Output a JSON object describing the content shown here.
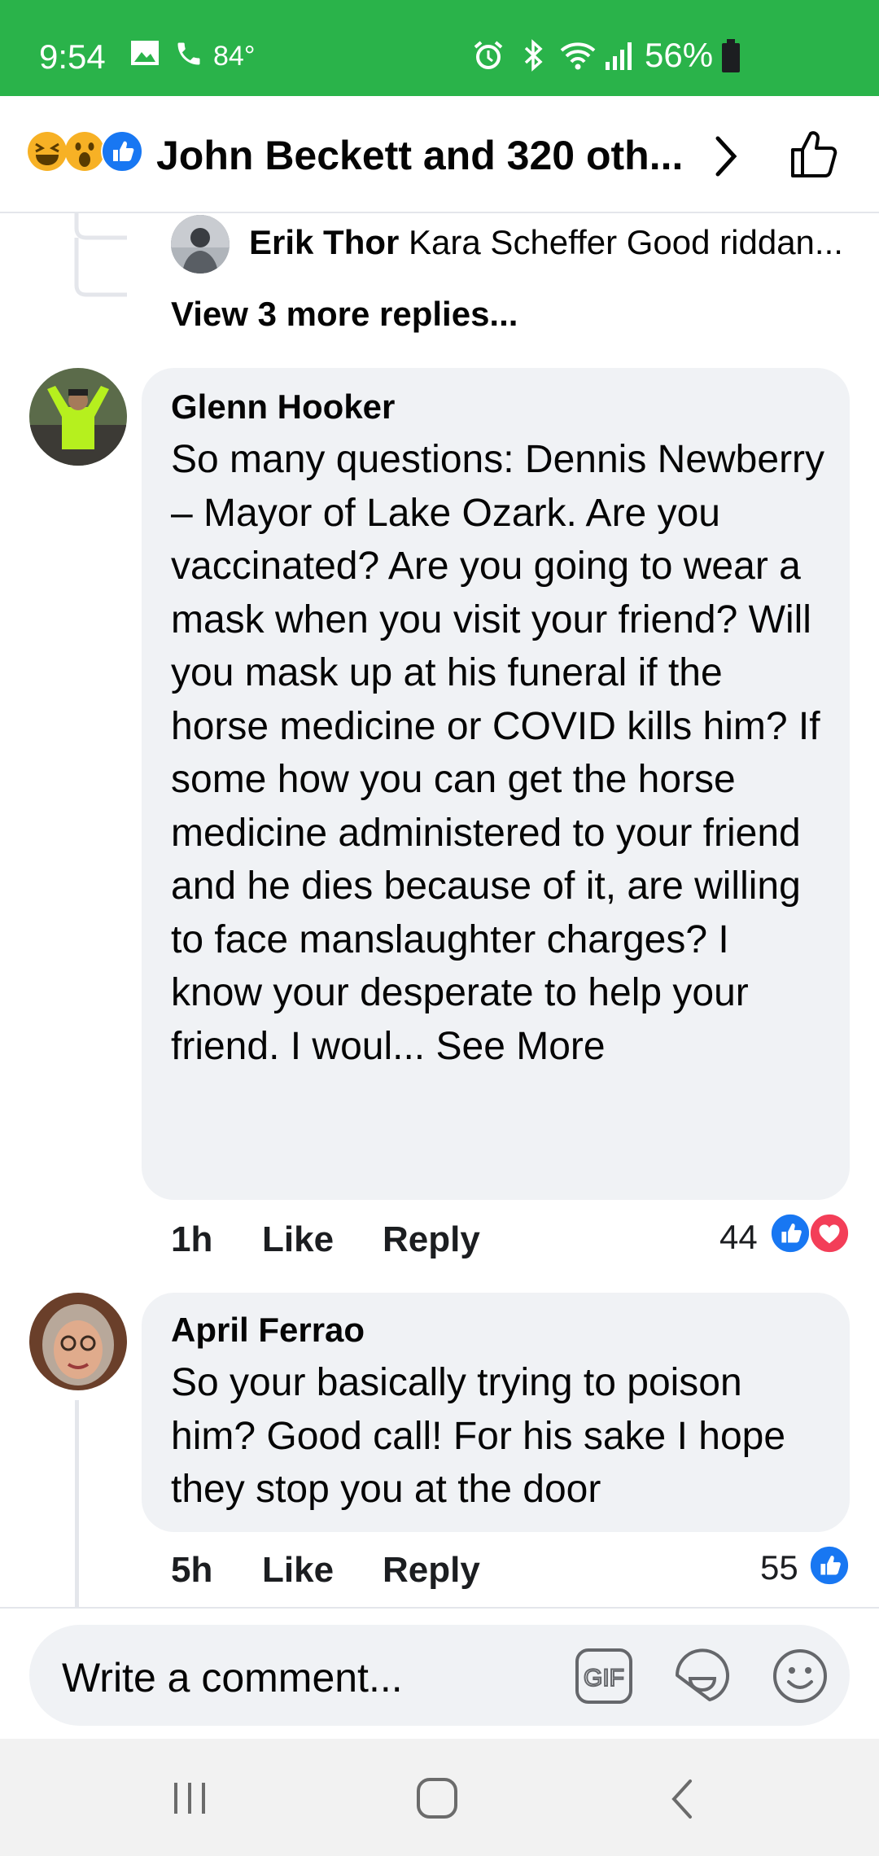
{
  "status_bar": {
    "time": "9:54",
    "temperature": "84°",
    "battery": "56%"
  },
  "header": {
    "title": "John Beckett and 320 oth...",
    "reactions": [
      "laugh-emoji",
      "wow-emoji",
      "like"
    ]
  },
  "previous_reply": {
    "author": "Erik Thor",
    "preview": "Kara Scheffer Good riddan..."
  },
  "view_more": "View 3 more replies...",
  "comments": [
    {
      "author": "Glenn Hooker",
      "text": "So many questions: Dennis Newberry –  Mayor of Lake Ozark. Are you vaccinated? Are you going to wear a mask when you visit your friend? Will you mask up at his funeral if the horse medicine or COVID kills him? If some how you can get the horse medicine administered to your friend and he dies because of it, are willing to face manslaughter charges?  I know your desperate to help your friend. I woul...",
      "see_more": "See More",
      "time": "1h",
      "like": "Like",
      "reply": "Reply",
      "reaction_count": "44",
      "reactions": [
        "like",
        "love"
      ]
    },
    {
      "author": "April Ferrao",
      "text": "So your basically trying to poison him?  Good call!  For his sake I hope they stop you at the door",
      "time": "5h",
      "like": "Like",
      "reply": "Reply",
      "reaction_count": "55",
      "reactions": [
        "like"
      ]
    }
  ],
  "composer": {
    "placeholder": "Write a comment..."
  },
  "colors": {
    "status_green": "#2ab34a",
    "fb_blue": "#1877f2",
    "love_red": "#f33e58",
    "bubble": "#f0f2f5"
  }
}
